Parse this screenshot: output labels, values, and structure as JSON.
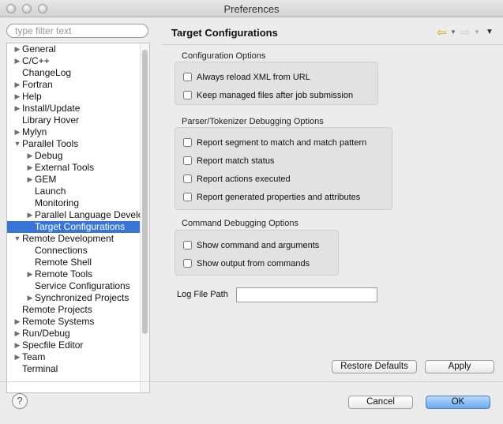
{
  "window": {
    "title": "Preferences"
  },
  "filter": {
    "placeholder": "type filter text"
  },
  "tree": [
    {
      "label": "General",
      "level": 0,
      "state": "collapsed"
    },
    {
      "label": "C/C++",
      "level": 0,
      "state": "collapsed"
    },
    {
      "label": "ChangeLog",
      "level": 0,
      "state": "leaf"
    },
    {
      "label": "Fortran",
      "level": 0,
      "state": "collapsed"
    },
    {
      "label": "Help",
      "level": 0,
      "state": "collapsed"
    },
    {
      "label": "Install/Update",
      "level": 0,
      "state": "collapsed"
    },
    {
      "label": "Library Hover",
      "level": 0,
      "state": "leaf"
    },
    {
      "label": "Mylyn",
      "level": 0,
      "state": "collapsed"
    },
    {
      "label": "Parallel Tools",
      "level": 0,
      "state": "expanded"
    },
    {
      "label": "Debug",
      "level": 1,
      "state": "collapsed"
    },
    {
      "label": "External Tools",
      "level": 1,
      "state": "collapsed"
    },
    {
      "label": "GEM",
      "level": 1,
      "state": "collapsed"
    },
    {
      "label": "Launch",
      "level": 1,
      "state": "leaf"
    },
    {
      "label": "Monitoring",
      "level": 1,
      "state": "leaf"
    },
    {
      "label": "Parallel Language Develo",
      "level": 1,
      "state": "collapsed"
    },
    {
      "label": "Target Configurations",
      "level": 1,
      "state": "leaf",
      "selected": true
    },
    {
      "label": "Remote Development",
      "level": 0,
      "state": "expanded"
    },
    {
      "label": "Connections",
      "level": 1,
      "state": "leaf"
    },
    {
      "label": "Remote Shell",
      "level": 1,
      "state": "leaf"
    },
    {
      "label": "Remote Tools",
      "level": 1,
      "state": "collapsed"
    },
    {
      "label": "Service Configurations",
      "level": 1,
      "state": "leaf"
    },
    {
      "label": "Synchronized Projects",
      "level": 1,
      "state": "collapsed"
    },
    {
      "label": "Remote Projects",
      "level": 0,
      "state": "leaf"
    },
    {
      "label": "Remote Systems",
      "level": 0,
      "state": "collapsed"
    },
    {
      "label": "Run/Debug",
      "level": 0,
      "state": "collapsed"
    },
    {
      "label": "Specfile Editor",
      "level": 0,
      "state": "collapsed"
    },
    {
      "label": "Team",
      "level": 0,
      "state": "collapsed"
    },
    {
      "label": "Terminal",
      "level": 0,
      "state": "leaf"
    }
  ],
  "page": {
    "title": "Target Configurations",
    "nav_icons": {
      "back": "back-arrow-icon",
      "forward": "forward-arrow-icon",
      "menu": "view-menu-icon"
    },
    "groups": [
      {
        "label": "Configuration Options",
        "options": [
          {
            "label": "Always reload XML from URL",
            "checked": false
          },
          {
            "label": "Keep managed files after job submission",
            "checked": false
          }
        ]
      },
      {
        "label": "Parser/Tokenizer Debugging Options",
        "options": [
          {
            "label": "Report segment to match and match pattern",
            "checked": false
          },
          {
            "label": "Report match status",
            "checked": false
          },
          {
            "label": "Report actions executed",
            "checked": false
          },
          {
            "label": "Report generated properties and attributes",
            "checked": false
          }
        ]
      },
      {
        "label": "Command Debugging Options",
        "options": [
          {
            "label": "Show command and arguments",
            "checked": false
          },
          {
            "label": "Show output from commands",
            "checked": false
          }
        ]
      }
    ],
    "log_file_path": {
      "label": "Log File Path",
      "value": ""
    },
    "restore_defaults_label": "Restore Defaults",
    "apply_label": "Apply"
  },
  "footer": {
    "help_glyph": "?",
    "cancel_label": "Cancel",
    "ok_label": "OK"
  },
  "colors": {
    "selection": "#3875d7",
    "default_button": "#6aa8ee"
  }
}
